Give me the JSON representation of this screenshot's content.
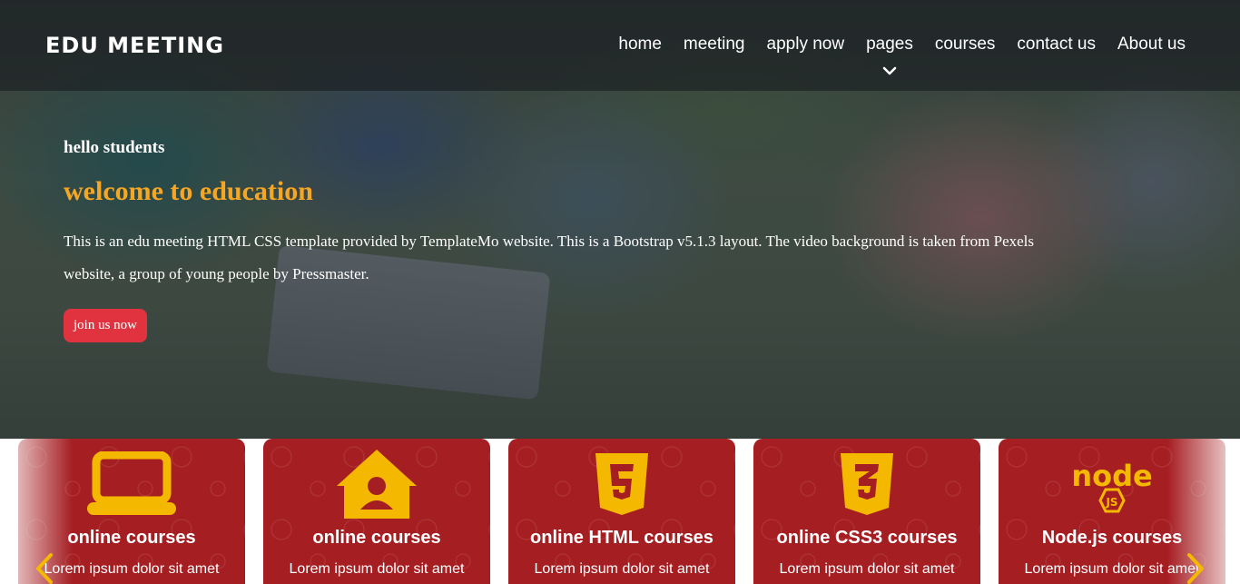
{
  "colors": {
    "accent": "#f5a623",
    "card_bg": "#a51e22",
    "icon_yellow": "#f5b800",
    "button_bg": "#e0333f"
  },
  "header": {
    "logo": "EDU MEETING",
    "nav": [
      {
        "label": "home"
      },
      {
        "label": "meeting"
      },
      {
        "label": "apply now"
      },
      {
        "label": "pages",
        "has_dropdown": true
      },
      {
        "label": "courses"
      },
      {
        "label": "contact us"
      },
      {
        "label": "About us"
      }
    ]
  },
  "hero": {
    "greeting": "hello students",
    "title": "welcome to education",
    "intro": "This is an edu meeting HTML CSS template provided by TemplateMo website. This is a Bootstrap v5.1.3 layout. The video background is taken from Pexels website, a group of young people by Pressmaster.",
    "cta": "join us now"
  },
  "cards": [
    {
      "icon": "laptop-icon",
      "title": "online courses",
      "text": "Lorem ipsum dolor sit amet"
    },
    {
      "icon": "home-user-icon",
      "title": "online courses",
      "text": "Lorem ipsum dolor sit amet"
    },
    {
      "icon": "html5-icon",
      "title": "online HTML courses",
      "text": "Lorem ipsum dolor sit amet"
    },
    {
      "icon": "css3-icon",
      "title": "online CSS3 courses",
      "text": "Lorem ipsum dolor sit amet"
    },
    {
      "icon": "nodejs-icon",
      "title": "Node.js courses",
      "text": "Lorem ipsum dolor sit amet"
    }
  ],
  "carousel": {
    "prev_icon": "chevron-left-icon",
    "next_icon": "chevron-right-icon"
  }
}
